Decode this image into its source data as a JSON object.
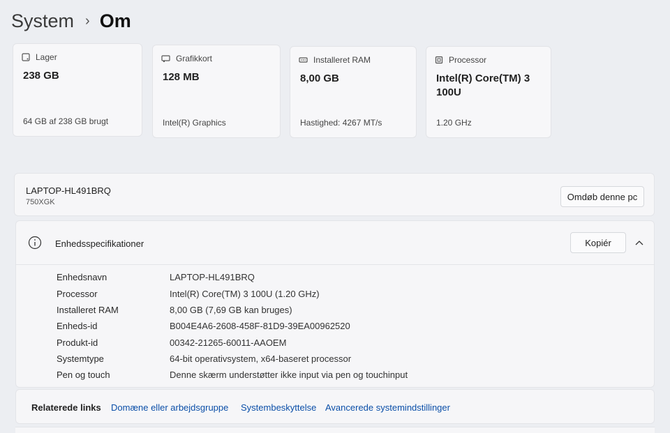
{
  "breadcrumb": {
    "root": "System",
    "separator": "›",
    "current": "Om"
  },
  "cards": [
    {
      "label": "Lager",
      "icon": "storage-icon",
      "value": "238 GB",
      "sub": "64 GB af 238 GB brugt"
    },
    {
      "label": "Grafikkort",
      "icon": "graphics-card-icon",
      "value": "128 MB",
      "sub": "Intel(R) Graphics"
    },
    {
      "label": "Installeret RAM",
      "icon": "ram-icon",
      "value": "8,00 GB",
      "sub": "Hastighed: 4267 MT/s"
    },
    {
      "label": "Processor",
      "icon": "processor-icon",
      "value": "Intel(R) Core(TM) 3 100U",
      "sub": "1.20 GHz"
    }
  ],
  "device": {
    "name": "LAPTOP-HL491BRQ",
    "model": "750XGK",
    "rename_label": "Omdøb denne pc"
  },
  "specs": {
    "title": "Enhedsspecifikationer",
    "copy_label": "Kopiér",
    "rows": [
      {
        "key": "Enhedsnavn",
        "value": "LAPTOP-HL491BRQ"
      },
      {
        "key": "Processor",
        "value": "Intel(R) Core(TM) 3 100U (1.20 GHz)"
      },
      {
        "key": "Installeret RAM",
        "value": "8,00 GB (7,69 GB kan bruges)"
      },
      {
        "key": "Enheds-id",
        "value": "B004E4A6-2608-458F-81D9-39EA00962520"
      },
      {
        "key": "Produkt-id",
        "value": "00342-21265-60011-AAOEM"
      },
      {
        "key": "Systemtype",
        "value": "64-bit operativsystem, x64-baseret processor"
      },
      {
        "key": "Pen og touch",
        "value": "Denne skærm understøtter ikke input via pen og touchinput"
      }
    ]
  },
  "related": {
    "title": "Relaterede links",
    "links": [
      "Domæne eller arbejdsgruppe",
      "Systembeskyttelse",
      "Avancerede systemindstillinger"
    ]
  }
}
